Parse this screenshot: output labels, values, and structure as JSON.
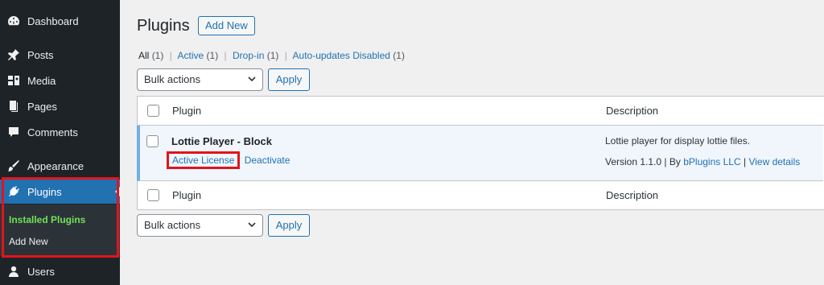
{
  "sidebar": {
    "items": [
      {
        "label": "Dashboard",
        "icon": "dashboard-icon"
      },
      {
        "label": "Posts",
        "icon": "pin-icon"
      },
      {
        "label": "Media",
        "icon": "media-icon"
      },
      {
        "label": "Pages",
        "icon": "pages-icon"
      },
      {
        "label": "Comments",
        "icon": "comment-icon"
      },
      {
        "label": "Appearance",
        "icon": "brush-icon"
      },
      {
        "label": "Plugins",
        "icon": "plugin-icon"
      },
      {
        "label": "Users",
        "icon": "user-icon"
      }
    ],
    "submenu": {
      "installed": "Installed Plugins",
      "add_new": "Add New"
    }
  },
  "header": {
    "title": "Plugins",
    "add_new": "Add New"
  },
  "filters": {
    "all": "All",
    "all_count": "(1)",
    "active": "Active",
    "active_count": "(1)",
    "dropin": "Drop-in",
    "dropin_count": "(1)",
    "autoupdates": "Auto-updates Disabled",
    "autoupdates_count": "(1)",
    "separator": "|"
  },
  "bulk": {
    "label": "Bulk actions",
    "apply": "Apply"
  },
  "table": {
    "col_plugin": "Plugin",
    "col_description": "Description",
    "plugin": {
      "name": "Lottie Player - Block",
      "action_license": "Active License",
      "action_deactivate": "Deactivate",
      "description": "Lottie player for display lottie files.",
      "version": "Version 1.1.0",
      "by": "By",
      "author": "bPlugins LLC",
      "view_details": "View details",
      "sep": "|"
    }
  },
  "colors": {
    "sidebar_bg": "#1d2327",
    "accent": "#2271b1",
    "highlight": "#e2141c",
    "current_sub": "#72e05a"
  }
}
